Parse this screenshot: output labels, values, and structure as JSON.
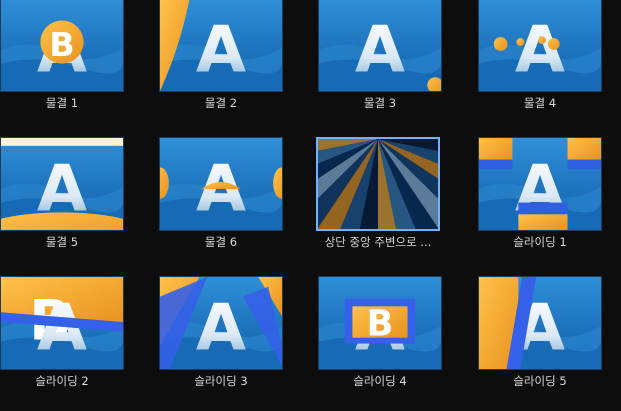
{
  "transitions": [
    {
      "label": "물결 1",
      "effect": "ripple-circle"
    },
    {
      "label": "물결 2",
      "effect": "ripple-corner"
    },
    {
      "label": "물결 3",
      "effect": "ripple-small"
    },
    {
      "label": "물결 4",
      "effect": "ripple-dots"
    },
    {
      "label": "물결 5",
      "effect": "ripple-bands"
    },
    {
      "label": "물결 6",
      "effect": "ripple-sides"
    },
    {
      "label": "상단 중앙 주변으로 ...",
      "effect": "fan-top",
      "selected": true
    },
    {
      "label": "슬라이딩 1",
      "effect": "slide-boxes"
    },
    {
      "label": "슬라이딩 2",
      "effect": "slide-diagonal-band"
    },
    {
      "label": "슬라이딩 3",
      "effect": "slide-triangles"
    },
    {
      "label": "슬라이딩 4",
      "effect": "slide-center-box"
    },
    {
      "label": "슬라이딩 5",
      "effect": "slide-vertical-band"
    }
  ],
  "thumbnail_letters": {
    "front": "A",
    "back": "B"
  },
  "colors": {
    "background": "#0d0d0d",
    "thumb_blue": "#1f78c8",
    "thumb_orange": "#f2a93a",
    "selection": "#6fb3ff",
    "label": "#d8d8d8"
  }
}
